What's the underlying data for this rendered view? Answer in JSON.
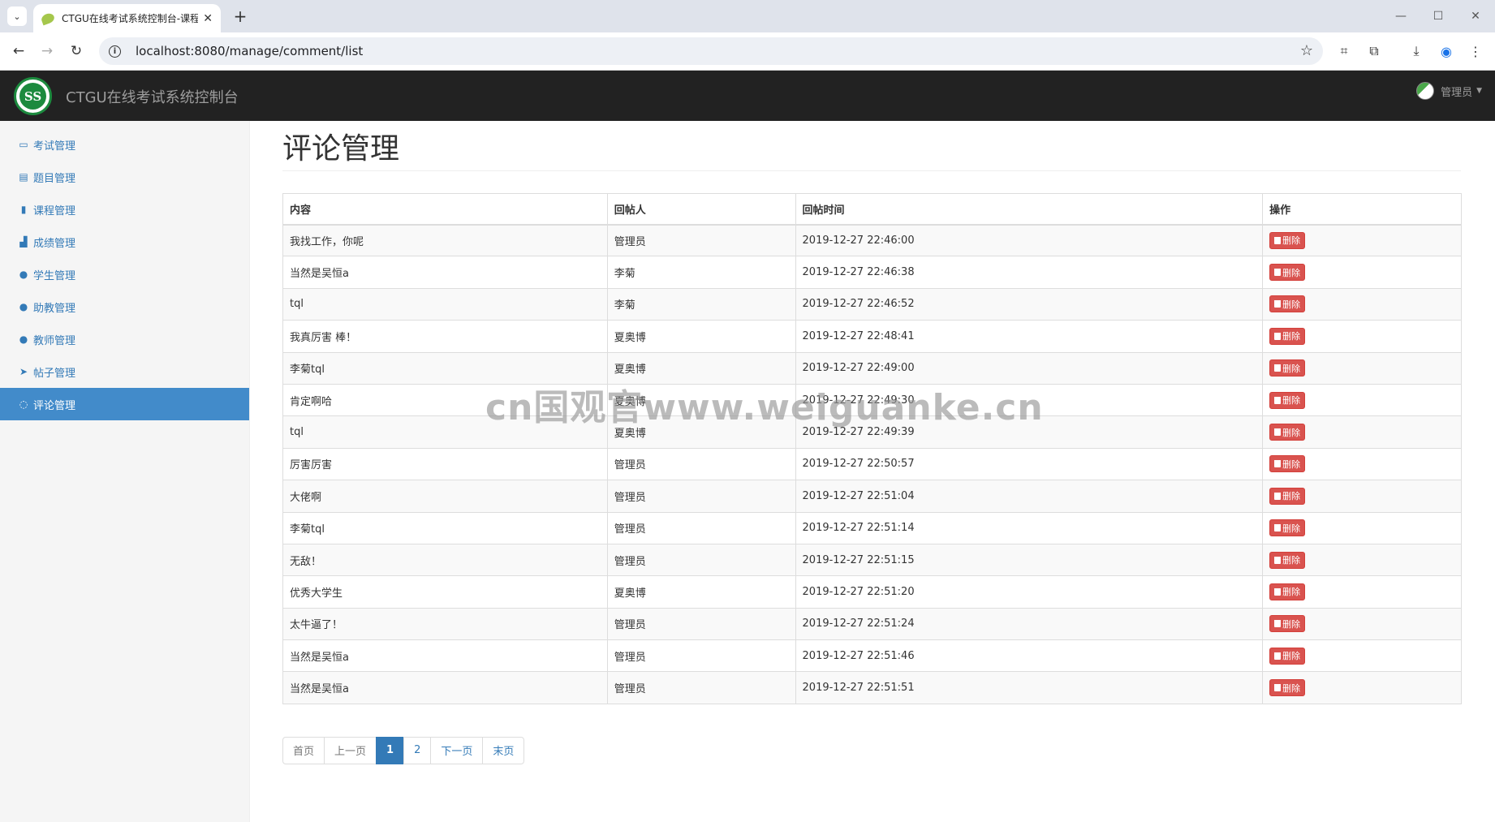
{
  "browser": {
    "tab_title": "CTGU在线考试系统控制台-课程",
    "url": "localhost:8080/manage/comment/list",
    "icons": [
      "tab-search-icon",
      "leaf-favicon-icon",
      "close-icon",
      "plus-icon",
      "minimize-icon",
      "maximize-icon",
      "close-window-icon",
      "back-icon",
      "forward-icon",
      "reload-icon",
      "info-icon",
      "star-icon",
      "crop-icon",
      "extension-icon",
      "download-icon",
      "profile-icon",
      "menu-icon"
    ]
  },
  "header": {
    "brand": "CTGU在线考试系统控制台",
    "logo_text": "SS",
    "user_name": "管理员"
  },
  "sidebar": {
    "items": [
      {
        "label": "考试管理",
        "icon": "monitor-icon",
        "glyph": "▭"
      },
      {
        "label": "题目管理",
        "icon": "book-list-icon",
        "glyph": "▤"
      },
      {
        "label": "课程管理",
        "icon": "book-icon",
        "glyph": "▮"
      },
      {
        "label": "成绩管理",
        "icon": "signal-icon",
        "glyph": "▟"
      },
      {
        "label": "学生管理",
        "icon": "user-icon",
        "glyph": "●"
      },
      {
        "label": "助教管理",
        "icon": "user-icon",
        "glyph": "●"
      },
      {
        "label": "教师管理",
        "icon": "user-icon",
        "glyph": "●"
      },
      {
        "label": "帖子管理",
        "icon": "send-icon",
        "glyph": "➤"
      },
      {
        "label": "评论管理",
        "icon": "comment-icon",
        "glyph": "◌"
      }
    ],
    "active_index": 8
  },
  "main": {
    "title": "评论管理",
    "table": {
      "headers": [
        "内容",
        "回帖人",
        "回帖时间",
        "操作"
      ],
      "delete_label": "删除",
      "rows": [
        {
          "content": "我找工作，你呢",
          "user": "管理员",
          "time": "2019-12-27 22:46:00"
        },
        {
          "content": "当然是吴恒a",
          "user": "李菊",
          "time": "2019-12-27 22:46:38"
        },
        {
          "content": "tql",
          "user": "李菊",
          "time": "2019-12-27 22:46:52"
        },
        {
          "content": "我真厉害 棒！",
          "user": "夏奥博",
          "time": "2019-12-27 22:48:41"
        },
        {
          "content": "李菊tql",
          "user": "夏奥博",
          "time": "2019-12-27 22:49:00"
        },
        {
          "content": "肯定啊哈",
          "user": "夏奥博",
          "time": "2019-12-27 22:49:30"
        },
        {
          "content": "tql",
          "user": "夏奥博",
          "time": "2019-12-27 22:49:39"
        },
        {
          "content": "厉害厉害",
          "user": "管理员",
          "time": "2019-12-27 22:50:57"
        },
        {
          "content": "大佬啊",
          "user": "管理员",
          "time": "2019-12-27 22:51:04"
        },
        {
          "content": "李菊tql",
          "user": "管理员",
          "time": "2019-12-27 22:51:14"
        },
        {
          "content": "无敌！",
          "user": "管理员",
          "time": "2019-12-27 22:51:15"
        },
        {
          "content": "优秀大学生",
          "user": "夏奥博",
          "time": "2019-12-27 22:51:20"
        },
        {
          "content": "太牛逼了！",
          "user": "管理员",
          "time": "2019-12-27 22:51:24"
        },
        {
          "content": "当然是吴恒a",
          "user": "管理员",
          "time": "2019-12-27 22:51:46"
        },
        {
          "content": "当然是吴恒a",
          "user": "管理员",
          "time": "2019-12-27 22:51:51"
        }
      ]
    },
    "pagination": {
      "first": "首页",
      "prev": "上一页",
      "pages": [
        "1",
        "2"
      ],
      "current": "1",
      "next": "下一页",
      "last": "末页"
    }
  },
  "watermark": "cn国观官www.weiguanke.cn",
  "colors": {
    "header_bg": "#222222",
    "sidebar_active": "#428bca",
    "link": "#337ab7",
    "danger": "#d9534f"
  }
}
